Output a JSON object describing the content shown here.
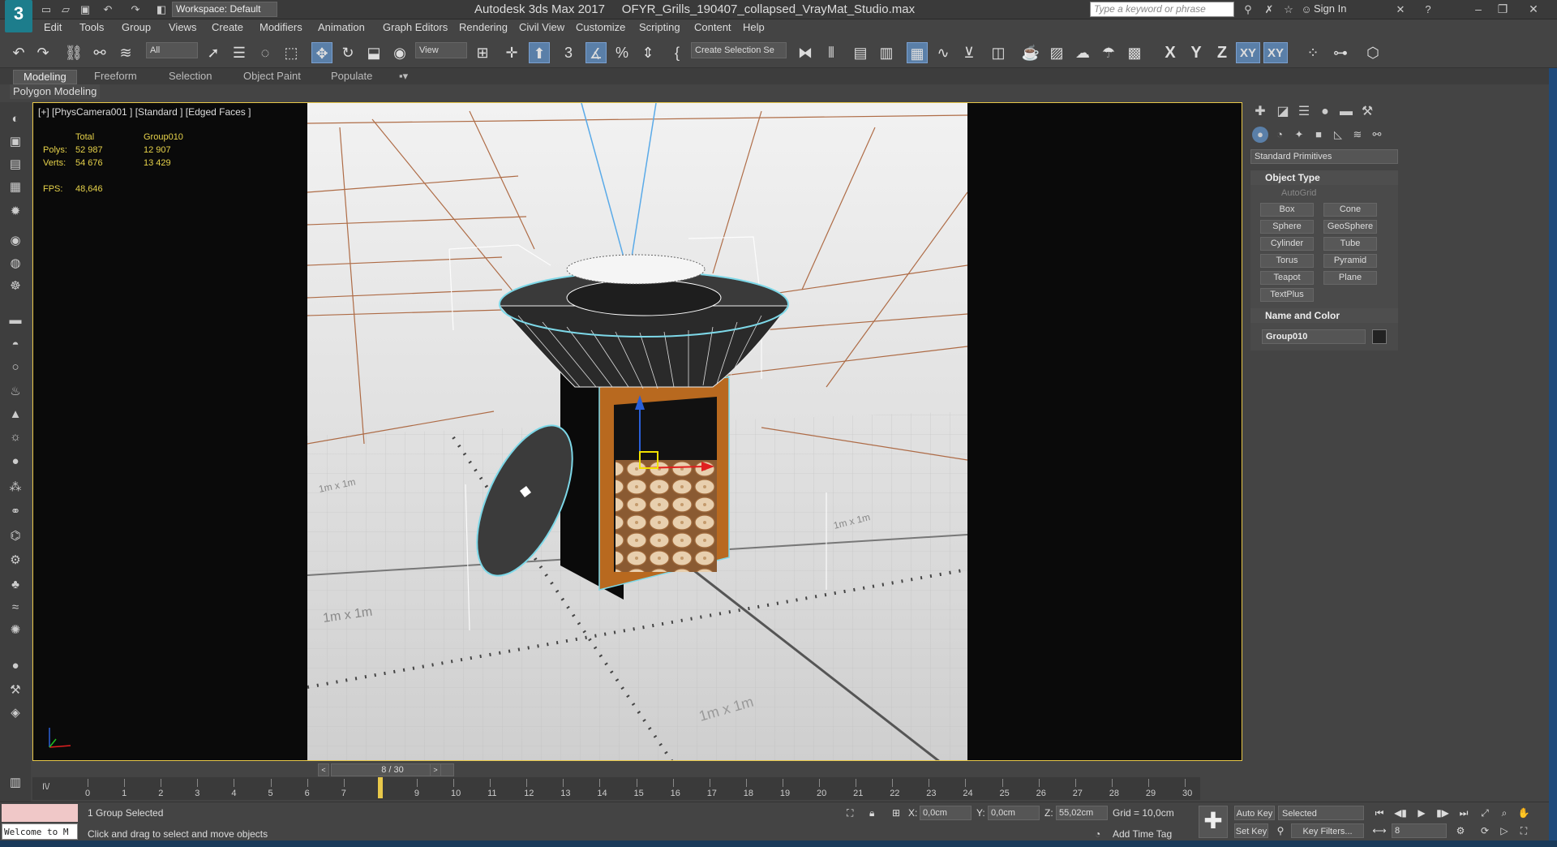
{
  "titlebar": {
    "app": "Autodesk 3ds Max 2017",
    "file": "OFYR_Grills_190407_collapsed_VrayMat_Studio.max",
    "workspace": "Workspace: Default",
    "search_placeholder": "Type a keyword or phrase",
    "signin": "Sign In"
  },
  "menu": [
    "Edit",
    "Tools",
    "Group",
    "Views",
    "Create",
    "Modifiers",
    "Animation",
    "Graph Editors",
    "Rendering",
    "Civil View",
    "Customize",
    "Scripting",
    "Content",
    "Help"
  ],
  "toolbar": {
    "filter": "All",
    "ref_coord": "View",
    "selection_set": "Create Selection Se",
    "axes": [
      "X",
      "Y",
      "Z",
      "XY",
      "XY"
    ]
  },
  "ribbon": {
    "tabs": [
      "Modeling",
      "Freeform",
      "Selection",
      "Object Paint",
      "Populate"
    ],
    "active_tab": "Modeling",
    "subpanel": "Polygon Modeling"
  },
  "viewport": {
    "label": "[+] [PhysCamera001 ] [Standard ] [Edged Faces ]",
    "stats": {
      "col_total": "Total",
      "col_group": "Group010",
      "polys_label": "Polys:",
      "polys_total": "52 987",
      "polys_group": "12 907",
      "verts_label": "Verts:",
      "verts_total": "54 676",
      "verts_group": "13 429",
      "fps_label": "FPS:",
      "fps_value": "48,646"
    },
    "grid_labels": [
      "1m x 1m",
      "1m x 1m",
      "1m x 1m",
      "1m x 1m"
    ]
  },
  "command_panel": {
    "category": "Standard Primitives",
    "object_type_title": "Object Type",
    "autogrid": "AutoGrid",
    "primitives": [
      "Box",
      "Cone",
      "Sphere",
      "GeoSphere",
      "Cylinder",
      "Tube",
      "Torus",
      "Pyramid",
      "Teapot",
      "Plane",
      "TextPlus"
    ],
    "name_color_title": "Name and Color",
    "object_name": "Group010"
  },
  "timeline": {
    "slider": "8 / 30",
    "ticks": [
      "0",
      "1",
      "2",
      "3",
      "4",
      "5",
      "6",
      "7",
      "8",
      "9",
      "10",
      "11",
      "12",
      "13",
      "14",
      "15",
      "16",
      "17",
      "18",
      "19",
      "20",
      "21",
      "22",
      "23",
      "24",
      "25",
      "26",
      "27",
      "28",
      "29",
      "30"
    ],
    "current_frame": 8
  },
  "status": {
    "listener": "Welcome to M",
    "selection": "1 Group Selected",
    "prompt": "Click and drag to select and move objects",
    "x_label": "X:",
    "x_value": "0,0cm",
    "y_label": "Y:",
    "y_value": "0,0cm",
    "z_label": "Z:",
    "z_value": "55,02cm",
    "grid": "Grid = 10,0cm",
    "add_time_tag": "Add Time Tag",
    "auto_key": "Auto Key",
    "set_key": "Set Key",
    "selected": "Selected",
    "key_filters": "Key Filters...",
    "frame_field": "8"
  },
  "colors": {
    "accent": "#5a7fa8",
    "viewport_border": "#e8c84a",
    "stats_text": "#e6d24a",
    "grill_wood": "#b5651d"
  }
}
